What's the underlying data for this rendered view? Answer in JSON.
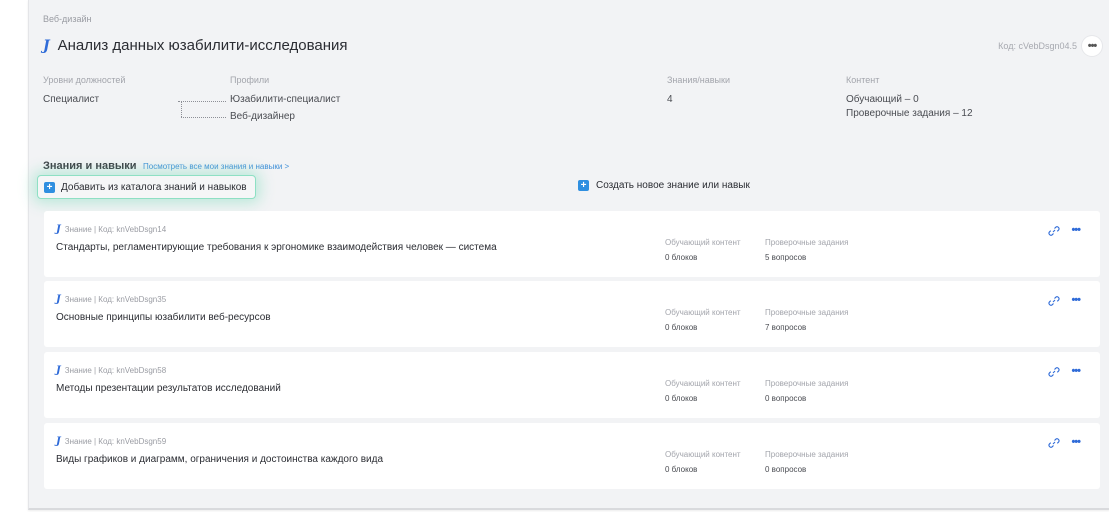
{
  "breadcrumb": "Веб-дизайн",
  "header": {
    "title": "Анализ данных юзабилити-исследования",
    "code": "Код: cVebDsgn04.5"
  },
  "info": {
    "levels_label": "Уровни должностей",
    "levels_value": "Специалист",
    "profiles_label": "Профили",
    "profiles": [
      "Юзабилити-специалист",
      "Веб-дизайнер"
    ],
    "skills_label": "Знания/навыки",
    "skills_value": "4",
    "content_label": "Контент",
    "content_lines": [
      "Обучающий – 0",
      "Проверочные задания – 12"
    ]
  },
  "section": {
    "title": "Знания и навыки",
    "link": "Посмотреть все мои знания и навыки >",
    "add_button": "Добавить из каталога знаний и навыков",
    "create_button": "Создать новое знание или навык"
  },
  "cards": [
    {
      "meta": "Знание | Код: knVebDsgn14",
      "name": "Стандарты, регламентирующие требования к эргономике взаимодействия человек — система",
      "content_label": "Обучающий контент",
      "content_value": "0 блоков",
      "tasks_label": "Проверочные задания",
      "tasks_value": "5 вопросов"
    },
    {
      "meta": "Знание | Код: knVebDsgn35",
      "name": "Основные принципы юзабилити веб-ресурсов",
      "content_label": "Обучающий контент",
      "content_value": "0 блоков",
      "tasks_label": "Проверочные задания",
      "tasks_value": "7 вопросов"
    },
    {
      "meta": "Знание | Код: knVebDsgn58",
      "name": "Методы презентации результатов исследований",
      "content_label": "Обучающий контент",
      "content_value": "0 блоков",
      "tasks_label": "Проверочные задания",
      "tasks_value": "0 вопросов"
    },
    {
      "meta": "Знание | Код: knVebDsgn59",
      "name": "Виды графиков и диаграмм, ограничения и достоинства каждого вида",
      "content_label": "Обучающий контент",
      "content_value": "0 блоков",
      "tasks_label": "Проверочные задания",
      "tasks_value": "0 вопросов"
    }
  ],
  "icons": {
    "title_icon": "j-logo-icon",
    "more": "more-dots-icon",
    "link": "link-icon",
    "plus": "plus-icon"
  },
  "colors": {
    "accent": "#2f6bd8",
    "button_highlight": "#8ee0c4",
    "plus_bg": "#2f8fe0"
  }
}
